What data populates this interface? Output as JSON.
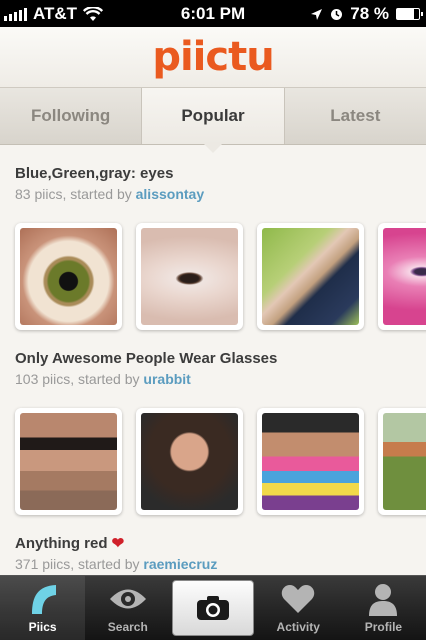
{
  "status_bar": {
    "carrier": "AT&T",
    "time": "6:01 PM",
    "battery": "78 %",
    "battery_level": 0.78
  },
  "app": {
    "logo": "piictu",
    "brand_color": "#ea5a1f",
    "link_color": "#5b9cbf"
  },
  "tabs": [
    {
      "label": "Following",
      "active": false
    },
    {
      "label": "Popular",
      "active": true
    },
    {
      "label": "Latest",
      "active": false
    }
  ],
  "sections": [
    {
      "title": "Blue,Green,gray: eyes",
      "count_text": "83 piics, started by",
      "user": "alissontay",
      "thumbs": [
        "green eye close-up",
        "brown eye close-up",
        "person lying on grass",
        "pink eye close-up"
      ]
    },
    {
      "title": "Only Awesome People Wear Glasses",
      "count_text": "103 piics, started by",
      "user": "urabbit",
      "thumbs": [
        "man with glasses",
        "woman with glasses",
        "tie-dye shirt glasses",
        "outdoor garden"
      ]
    },
    {
      "title": "Anything red",
      "count_text": "371 piics, started by",
      "user": "raemiecruz",
      "thumbs": []
    }
  ],
  "tabbar": {
    "items": [
      {
        "label": "Piics",
        "icon": "piics-icon",
        "active": true
      },
      {
        "label": "Search",
        "icon": "eye-icon",
        "active": false
      },
      {
        "label": "",
        "icon": "camera-icon",
        "active": false
      },
      {
        "label": "Activity",
        "icon": "heart-icon",
        "active": false
      },
      {
        "label": "Profile",
        "icon": "person-icon",
        "active": false
      }
    ]
  }
}
